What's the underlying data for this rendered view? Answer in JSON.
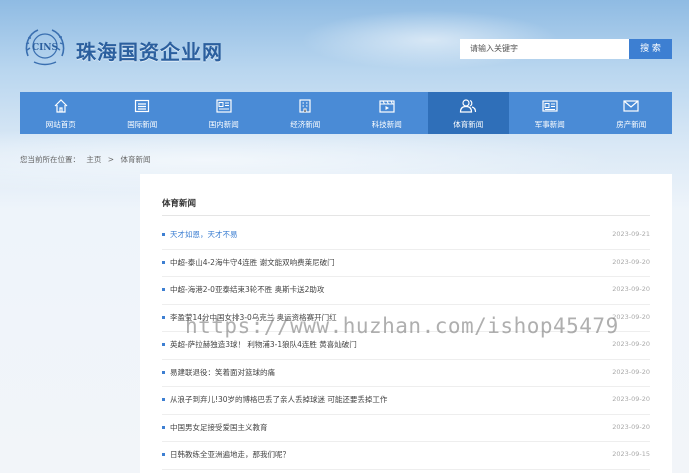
{
  "header": {
    "logo_text": "CINS",
    "site_title": "珠海国资企业网",
    "search_placeholder": "请输入关键字",
    "search_button": "搜 索"
  },
  "nav": [
    {
      "label": "网站首页",
      "icon": "home-icon",
      "active": false
    },
    {
      "label": "国际新闻",
      "icon": "newspaper-icon",
      "active": false
    },
    {
      "label": "国内新闻",
      "icon": "news-doc-icon",
      "active": false
    },
    {
      "label": "经济新闻",
      "icon": "building-icon",
      "active": false
    },
    {
      "label": "科技新闻",
      "icon": "video-icon",
      "active": false
    },
    {
      "label": "体育新闻",
      "icon": "users-icon",
      "active": true
    },
    {
      "label": "军事新闻",
      "icon": "id-card-icon",
      "active": false
    },
    {
      "label": "房产新闻",
      "icon": "mail-icon",
      "active": false
    }
  ],
  "breadcrumb": {
    "prefix": "您当前所在位置：",
    "home": "主页",
    "sep": ">",
    "current": "体育新闻"
  },
  "panel": {
    "title": "体育新闻",
    "items": [
      {
        "title": "天才如恩，天才不易",
        "date": "2023-09-21"
      },
      {
        "title": "中超-泰山4-2海牛守4连胜 谢文能双响费莱尼破门",
        "date": "2023-09-20"
      },
      {
        "title": "中超-海港2-0亚泰结束3轮不胜 奥斯卡送2助攻",
        "date": "2023-09-20"
      },
      {
        "title": "李盈莹14分中国女排3-0乌克兰 奥运资格赛开门红",
        "date": "2023-09-20"
      },
      {
        "title": "英超-萨拉赫独造3球！ 利物浦3-1狼队4连胜 黄喜灿破门",
        "date": "2023-09-20"
      },
      {
        "title": "易建联退役：笑着面对篮球的痛",
        "date": "2023-09-20"
      },
      {
        "title": "从浪子到弃儿!30岁的博格巴丢了亲人丢掉球迷 可能还要丢掉工作",
        "date": "2023-09-20"
      },
      {
        "title": "中国男女足接受爱国主义教育",
        "date": "2023-09-20"
      },
      {
        "title": "日韩教练全亚洲遍地走，那我们呢？",
        "date": "2023-09-15"
      }
    ]
  },
  "watermark": "https://www.huzhan.com/ishop45479",
  "colors": {
    "nav_bg": "#4a8bd6",
    "nav_active": "#2f6fb9",
    "accent": "#3d7fd2",
    "title": "#2b5f9e"
  }
}
